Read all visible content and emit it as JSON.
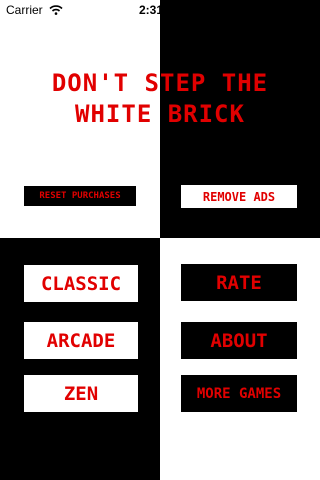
{
  "status_bar": {
    "carrier": "Carrier",
    "time": "2:31"
  },
  "title": {
    "line1": "DON'T STEP THE",
    "line2": "WHITE BRICK"
  },
  "buttons": {
    "reset_purchases": "RESET PURCHASES",
    "remove_ads": "REMOVE ADS",
    "classic": "CLASSIC",
    "arcade": "ARCADE",
    "zen": "ZEN",
    "rate": "RATE",
    "about": "ABOUT",
    "more_games": "MORE GAMES"
  },
  "colors": {
    "accent": "#e10000",
    "white_brick": "#ffffff",
    "black_brick": "#000000"
  }
}
